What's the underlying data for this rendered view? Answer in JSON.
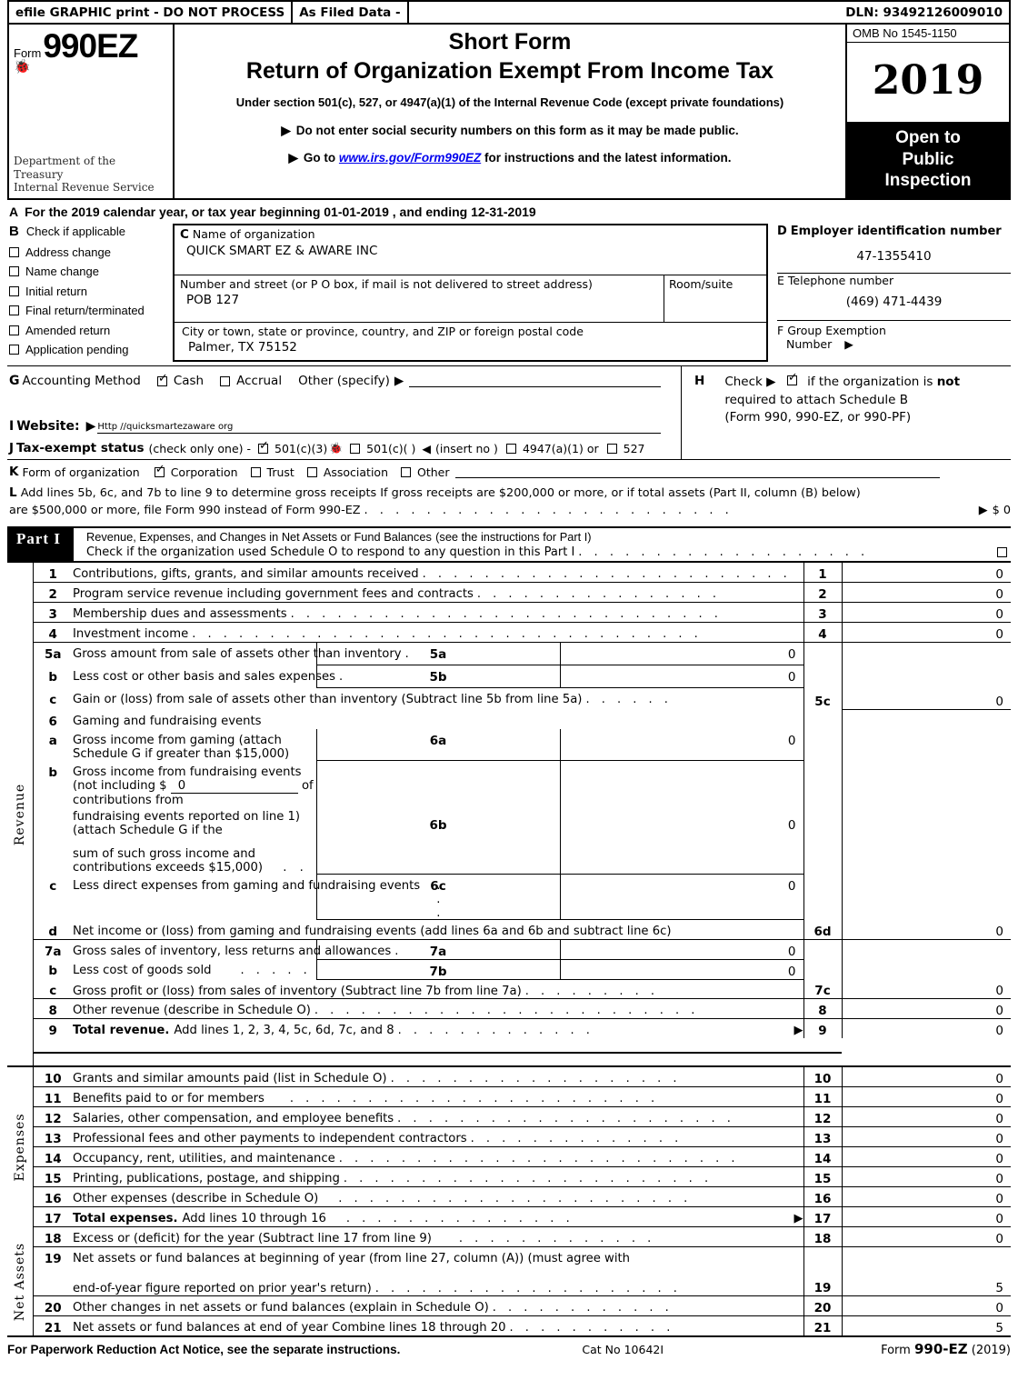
{
  "efile": {
    "graphic": "efile GRAPHIC print - DO NOT PROCESS",
    "asfiled": "As Filed Data -",
    "dln": "DLN: 93492126009010"
  },
  "masthead": {
    "form_word": "Form",
    "form_number": "990EZ",
    "dept_line1": "Department of the",
    "dept_line2": "Treasury",
    "dept_line3": "Internal Revenue Service",
    "title1": "Short Form",
    "title2": "Return of Organization Exempt From Income Tax",
    "under_section": "Under section 501(c), 527, or 4947(a)(1) of the Internal Revenue Code (except private foundations)",
    "bullet1": "Do not enter social security numbers on this form as it may be made public.",
    "bullet2_pre": "Go to",
    "bullet2_link": "www.irs.gov/Form990EZ",
    "bullet2_post": "for instructions and the latest information.",
    "omb": "OMB No  1545-1150",
    "year": "2019",
    "open_line1": "Open to",
    "open_line2": "Public",
    "open_line3": "Inspection"
  },
  "lineA": {
    "label": "A",
    "text": "For the 2019 calendar year, or tax year beginning 01-01-2019 , and ending 12-31-2019"
  },
  "sectionB": {
    "label": "B",
    "heading": "Check if applicable",
    "items": [
      {
        "label": "Address change",
        "checked": false
      },
      {
        "label": "Name change",
        "checked": false
      },
      {
        "label": "Initial return",
        "checked": false
      },
      {
        "label": "Final return/terminated",
        "checked": false
      },
      {
        "label": "Amended return",
        "checked": false
      },
      {
        "label": "Application pending",
        "checked": false
      }
    ]
  },
  "sectionC": {
    "label": "C",
    "name_caption": "Name of organization",
    "org_name": "QUICK SMART EZ & AWARE INC",
    "street_caption": "Number and street (or P  O  box, if mail is not delivered to street address)",
    "street": "POB 127",
    "room_caption": "Room/suite",
    "room": "",
    "city_caption": "City or town, state or province, country, and ZIP or foreign postal code",
    "city": "Palmer, TX  75152"
  },
  "sectionD": {
    "label": "D",
    "caption": "Employer identification number",
    "value": "47-1355410"
  },
  "sectionE": {
    "label": "E",
    "caption": "Telephone number",
    "value": "(469) 471-4439"
  },
  "sectionF": {
    "label": "F",
    "caption_line1": "Group Exemption",
    "caption_line2": "Number",
    "value": ""
  },
  "sectionG": {
    "label": "G",
    "caption": "Accounting Method",
    "cash": "Cash",
    "cash_checked": true,
    "accrual": "Accrual",
    "accrual_checked": false,
    "other": "Other (specify)",
    "other_value": ""
  },
  "sectionH": {
    "label": "H",
    "check_word": "Check",
    "checked": true,
    "text_pre": "if the organization is",
    "text_bold": "not",
    "line2": "required to attach Schedule B",
    "line3": "(Form 990, 990-EZ, or 990-PF)"
  },
  "sectionI": {
    "label": "I",
    "caption": "Website:",
    "url": "Http //quicksmartezaware org"
  },
  "sectionJ": {
    "label": "J",
    "caption": "Tax-exempt status",
    "note": "(check only one) -",
    "opt1": "501(c)(3)",
    "opt1_checked": true,
    "opt2": "501(c)(   )",
    "opt2_checked": false,
    "insert": "(insert no )",
    "opt3": "4947(a)(1) or",
    "opt3_checked": false,
    "opt4": "527",
    "opt4_checked": false
  },
  "sectionK": {
    "label": "K",
    "caption": "Form of organization",
    "options": [
      {
        "label": "Corporation",
        "checked": true
      },
      {
        "label": "Trust",
        "checked": false
      },
      {
        "label": "Association",
        "checked": false
      },
      {
        "label": "Other",
        "checked": false
      }
    ]
  },
  "sectionL": {
    "label": "L",
    "line1": "Add lines 5b, 6c, and 7b to line 9 to determine gross receipts  If gross receipts are $200,000 or more, or if total assets (Part II, column (B) below)",
    "line2": "are $500,000 or more, file Form 990 instead of Form 990-EZ",
    "value": "$ 0"
  },
  "partI": {
    "tag": "Part I",
    "title": "Revenue, Expenses, and Changes in Net Assets or Fund Balances",
    "title_note": "(see the instructions for Part I)",
    "subtitle": "Check if the organization used Schedule O to respond to any question in this Part I",
    "checked": false
  },
  "sidebars": {
    "revenue": "Revenue",
    "expenses": "Expenses",
    "net_assets": "Net Assets"
  },
  "revenue_rows": [
    {
      "num": "1",
      "desc": "Contributions, gifts, grants, and similar amounts received",
      "bignum": "1",
      "bigval": "0"
    },
    {
      "num": "2",
      "desc": "Program service revenue including government fees and contracts",
      "bignum": "2",
      "bigval": "0"
    },
    {
      "num": "3",
      "desc": "Membership dues and assessments",
      "bignum": "3",
      "bigval": "0"
    },
    {
      "num": "4",
      "desc": "Investment income",
      "bignum": "4",
      "bigval": "0"
    },
    {
      "num": "5a",
      "desc": "Gross amount from sale of assets other than inventory",
      "mininum": "5a",
      "minival": "0"
    },
    {
      "num": "b",
      "desc": "Less  cost or other basis and sales expenses",
      "mininum": "5b",
      "minival": "0"
    },
    {
      "num": "c",
      "desc": "Gain or (loss) from sale of assets other than inventory (Subtract line 5b from line 5a)",
      "bignum": "5c",
      "bigval": "0"
    },
    {
      "num": "6",
      "desc": "Gaming and fundraising events"
    },
    {
      "num": "a",
      "desc": "Gross income from gaming (attach Schedule G if greater than $15,000)",
      "mininum": "6a",
      "minival": "0"
    },
    {
      "num": "b",
      "desc": "Gross income from fundraising events (not including $",
      "desc_inline_value": "0",
      "desc_post": "of contributions from",
      "desc_line2": "fundraising events reported on line 1) (attach Schedule G if the",
      "desc_line3": "sum of such gross income and contributions exceeds $15,000)",
      "mininum": "6b",
      "minival": "0"
    },
    {
      "num": "c",
      "desc": "Less  direct expenses from gaming and fundraising events",
      "mininum": "6c",
      "minival": "0"
    },
    {
      "num": "d",
      "desc": "Net income or (loss) from gaming and fundraising events (add lines 6a and 6b and subtract line 6c)",
      "bignum": "6d",
      "bigval": "0"
    },
    {
      "num": "7a",
      "desc": "Gross sales of inventory, less returns and allowances",
      "mininum": "7a",
      "minival": "0"
    },
    {
      "num": "b",
      "desc": "Less  cost of goods sold",
      "mininum": "7b",
      "minival": "0"
    },
    {
      "num": "c",
      "desc": "Gross profit or (loss) from sales of inventory (Subtract line 7b from line 7a)",
      "bignum": "7c",
      "bigval": "0"
    },
    {
      "num": "8",
      "desc": "Other revenue (describe in Schedule O)",
      "bignum": "8",
      "bigval": "0"
    },
    {
      "num": "9",
      "desc_bold": "Total revenue.",
      "desc": "Add lines 1, 2, 3, 4, 5c, 6d, 7c, and 8",
      "bignum": "9",
      "bigval": "0",
      "arrow": true
    }
  ],
  "expense_rows": [
    {
      "num": "10",
      "desc": "Grants and similar amounts paid (list in Schedule O)",
      "bignum": "10",
      "bigval": "0"
    },
    {
      "num": "11",
      "desc": "Benefits paid to or for members",
      "bignum": "11",
      "bigval": "0"
    },
    {
      "num": "12",
      "desc": "Salaries, other compensation, and employee benefits",
      "bignum": "12",
      "bigval": "0"
    },
    {
      "num": "13",
      "desc": "Professional fees and other payments to independent contractors",
      "bignum": "13",
      "bigval": "0"
    },
    {
      "num": "14",
      "desc": "Occupancy, rent, utilities, and maintenance",
      "bignum": "14",
      "bigval": "0"
    },
    {
      "num": "15",
      "desc": "Printing, publications, postage, and shipping",
      "bignum": "15",
      "bigval": "0"
    },
    {
      "num": "16",
      "desc": "Other expenses (describe in Schedule O)",
      "bignum": "16",
      "bigval": "0"
    },
    {
      "num": "17",
      "desc_bold": "Total expenses.",
      "desc": "Add lines 10 through 16",
      "bignum": "17",
      "bigval": "0",
      "arrow": true
    }
  ],
  "netasset_rows": [
    {
      "num": "18",
      "desc": "Excess or (deficit) for the year (Subtract line 17 from line 9)",
      "bignum": "18",
      "bigval": "0"
    },
    {
      "num": "19",
      "desc": "Net assets or fund balances at beginning of year (from line 27, column (A)) (must agree with",
      "desc_line2": "end-of-year figure reported on prior year's return)",
      "bignum": "19",
      "bigval": "5"
    },
    {
      "num": "20",
      "desc": "Other changes in net assets or fund balances (explain in Schedule O)",
      "bignum": "20",
      "bigval": "0"
    },
    {
      "num": "21",
      "desc": "Net assets or fund balances at end of year  Combine lines 18 through 20",
      "bignum": "21",
      "bigval": "5"
    }
  ],
  "footer": {
    "paperwork": "For Paperwork Reduction Act Notice, see the separate instructions.",
    "cat": "Cat  No  10642I",
    "form_pre": "Form",
    "form_bold": "990-EZ",
    "form_year": "(2019)"
  }
}
